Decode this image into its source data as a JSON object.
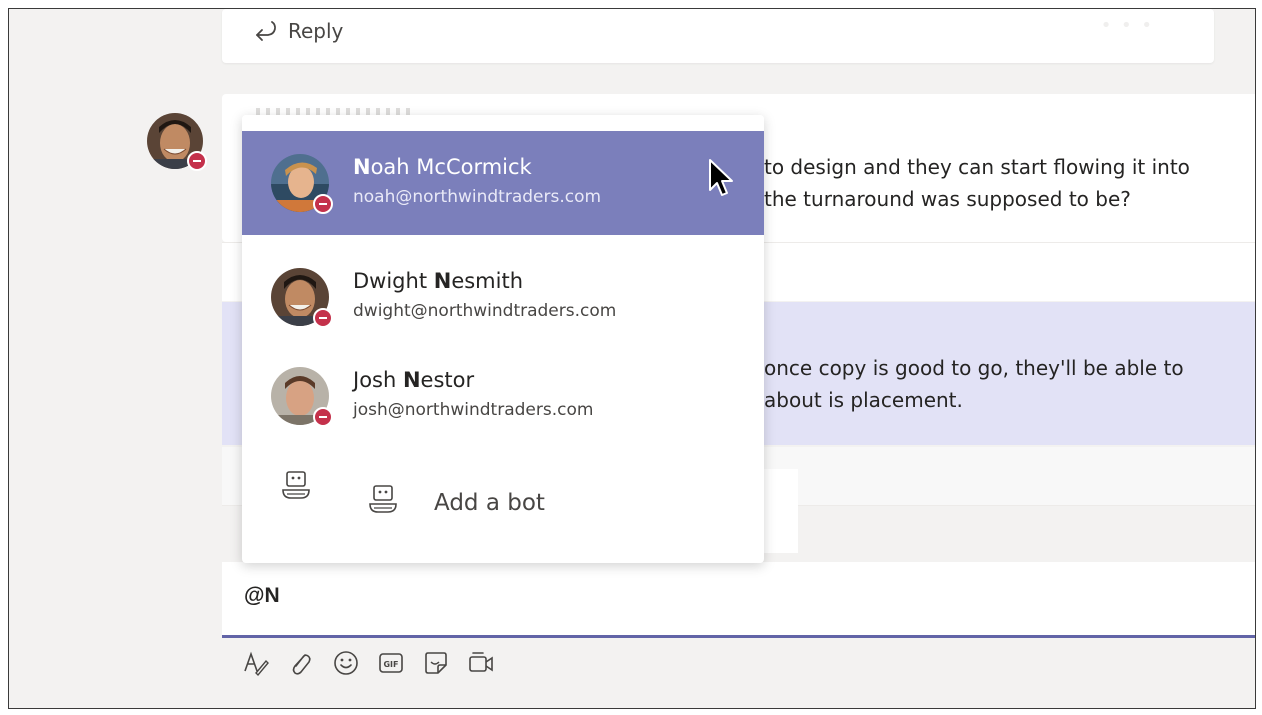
{
  "thread": {
    "reply_label": "Reply"
  },
  "messages": [
    {
      "lines": [
        "to design and they can start flowing it into",
        "the turnaround was supposed to be?"
      ]
    },
    {
      "lines": [
        "once copy is good to go, they'll be able to",
        "about is placement."
      ]
    }
  ],
  "mention_popup": {
    "people": [
      {
        "name_prefix": "",
        "name_match": "N",
        "name_rest": "oah McCormick",
        "email": "noah@northwindtraders.com",
        "status": "do-not-disturb",
        "selected": true
      },
      {
        "name_prefix": "Dwight ",
        "name_match": "N",
        "name_rest": "esmith",
        "email": "dwight@northwindtraders.com",
        "status": "do-not-disturb",
        "selected": false
      },
      {
        "name_prefix": "Josh ",
        "name_match": "N",
        "name_rest": "estor",
        "email": "josh@northwindtraders.com",
        "status": "do-not-disturb",
        "selected": false
      }
    ],
    "add_bot_label": "Add a bot"
  },
  "compose": {
    "text": "@N"
  },
  "toolbar": {
    "tools": [
      "format-icon",
      "attach-icon",
      "emoji-icon",
      "gif-icon",
      "sticker-icon",
      "meet-now-icon"
    ]
  },
  "colors": {
    "accent": "#6264a7",
    "selected_row": "#7b7fbb",
    "highlight_message": "#e2e2f6",
    "presence_busy": "#c4314b"
  }
}
